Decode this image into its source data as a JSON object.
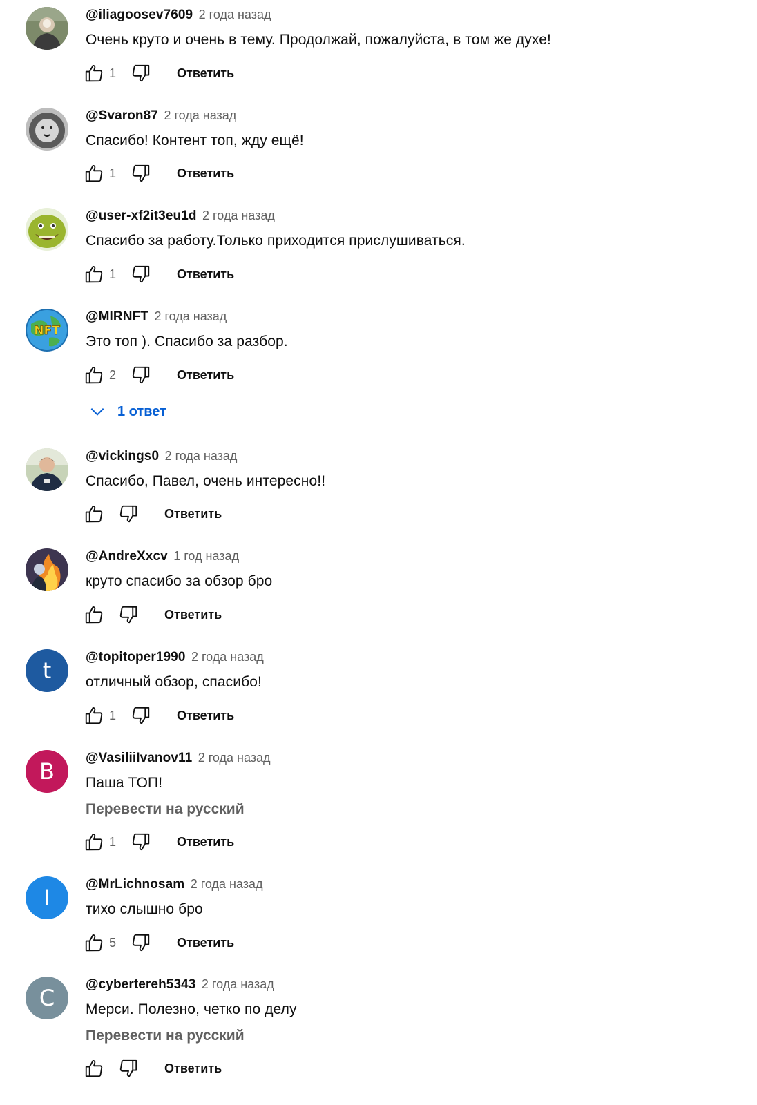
{
  "comments": [
    {
      "author": "@iliagoosev7609",
      "time": "2 года назад",
      "text": "Очень круто и очень в тему. Продолжай, пожалуйста, в том же духе!",
      "likes": "1",
      "reply_label": "Ответить",
      "avatar": "photo-man-icon",
      "color": "#6d7a5a"
    },
    {
      "author": "@Svaron87",
      "time": "2 года назад",
      "text": "Спасибо! Контент топ, жду ещё!",
      "likes": "1",
      "reply_label": "Ответить",
      "avatar": "lion-icon",
      "color": "#8a8a8a"
    },
    {
      "author": "@user-xf2it3eu1d",
      "time": "2 года назад",
      "text": "Спасибо за работу.Только приходится прислушиваться.",
      "likes": "1",
      "reply_label": "Ответить",
      "avatar": "shrek-icon",
      "color": "#8fa82c"
    },
    {
      "author": "@MIRNFT",
      "time": "2 года назад",
      "text": "Это топ ). Спасибо за разбор.",
      "likes": "2",
      "reply_label": "Ответить",
      "avatar": "nft-globe-icon",
      "color": "#2e8fd0"
    },
    {
      "author": "@vickings0",
      "time": "2 года назад",
      "text": "Спасибо, Павел, очень интересно!!",
      "likes": "",
      "reply_label": "Ответить",
      "avatar": "photo-person-icon",
      "color": "#2f3a4a"
    },
    {
      "author": "@AndreXxcv",
      "time": "1 год назад",
      "text": "круто спасибо за обзор бро",
      "likes": "",
      "reply_label": "Ответить",
      "avatar": "fire-art-icon",
      "color": "#4a3a5a"
    },
    {
      "author": "@topitoper1990",
      "time": "2 года назад",
      "text": "отличный обзор, спасибо!",
      "likes": "1",
      "reply_label": "Ответить",
      "avatar": "letter-avatar",
      "letter": "t",
      "color": "#1e5aa0"
    },
    {
      "author": "@VasiliiIvanov11",
      "time": "2 года назад",
      "text": "Паша ТОП!",
      "translate": "Перевести на русский",
      "likes": "1",
      "reply_label": "Ответить",
      "avatar": "letter-avatar",
      "letter": "B",
      "color": "#c2185b"
    },
    {
      "author": "@MrLichnosam",
      "time": "2 года назад",
      "text": "тихо слышно бро",
      "likes": "5",
      "reply_label": "Ответить",
      "avatar": "letter-avatar",
      "letter": "I",
      "color": "#1e88e5"
    },
    {
      "author": "@cybertereh5343",
      "time": "2 года назад",
      "text": "Мерси. Полезно, четко по делу",
      "translate": "Перевести на русский",
      "likes": "",
      "reply_label": "Ответить",
      "avatar": "letter-avatar",
      "letter": "C",
      "color": "#78909c"
    }
  ],
  "replies_toggle": {
    "label": "1 ответ",
    "icon": "chevron-down-icon",
    "color": "#065fd4"
  }
}
